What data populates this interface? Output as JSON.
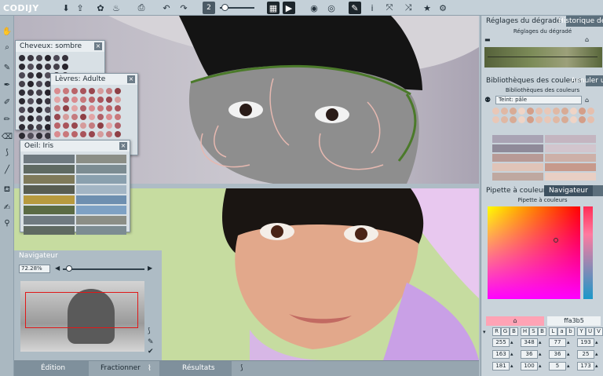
{
  "toolbar": {
    "logo": "CODIJY",
    "brush_size": "2"
  },
  "palettes": {
    "hair": {
      "title": "Cheveux: sombre",
      "colors": [
        "#2e2c35",
        "#3a3640",
        "#44404a",
        "#26232b",
        "#4b4754",
        "#35313b",
        "#2b2931",
        "#514c58"
      ]
    },
    "lips": {
      "title": "Lèvres: Adulte",
      "colors": [
        "#d98b8f",
        "#c9787b",
        "#b96368",
        "#a9545b",
        "#98474f",
        "#d59b9b",
        "#c47b7f",
        "#8e4046",
        "#e2a4a5",
        "#b06068"
      ]
    },
    "eye": {
      "title": "Oeil: Iris",
      "colors": [
        "#6f7a80",
        "#8b8e86",
        "#5f6a62",
        "#7c8c92",
        "#7f7a5a",
        "#8aa0ae",
        "#585d52",
        "#a3b5c4",
        "#b79a3f",
        "#6e8fb0",
        "#5b6b44",
        "#7ea1c4"
      ]
    }
  },
  "navigator": {
    "title": "Navigateur",
    "zoom": "72.28%"
  },
  "bottom_tabs": {
    "edition": "Édition",
    "fractionner": "Fractionner",
    "resultats": "Résultats"
  },
  "right_panel": {
    "gradient_tab": "Réglages du dégradé",
    "history_tab": "Historique des",
    "gradient_sub": "Réglages du dégradé",
    "libraries_tab": "Bibliothèques des couleurs",
    "undo_tab": "Annuler u",
    "libraries_sub": "Bibliothèques des couleurs",
    "preset": "Teint: pâle",
    "picker_tab": "Pipette à couleurs",
    "navigator_tab": "Navigateur",
    "picker_sub": "Pipette à couleurs",
    "hex": "ffa3b5",
    "channel_labels": [
      "R",
      "G",
      "B",
      "H",
      "S",
      "B",
      "L",
      "a",
      "b",
      "Y",
      "U",
      "V"
    ],
    "values": [
      [
        "255",
        "348",
        "77",
        "193"
      ],
      [
        "163",
        "36",
        "36",
        "25"
      ],
      [
        "181",
        "100",
        "5",
        "173"
      ]
    ],
    "accent_color": "#ffa3b5"
  }
}
